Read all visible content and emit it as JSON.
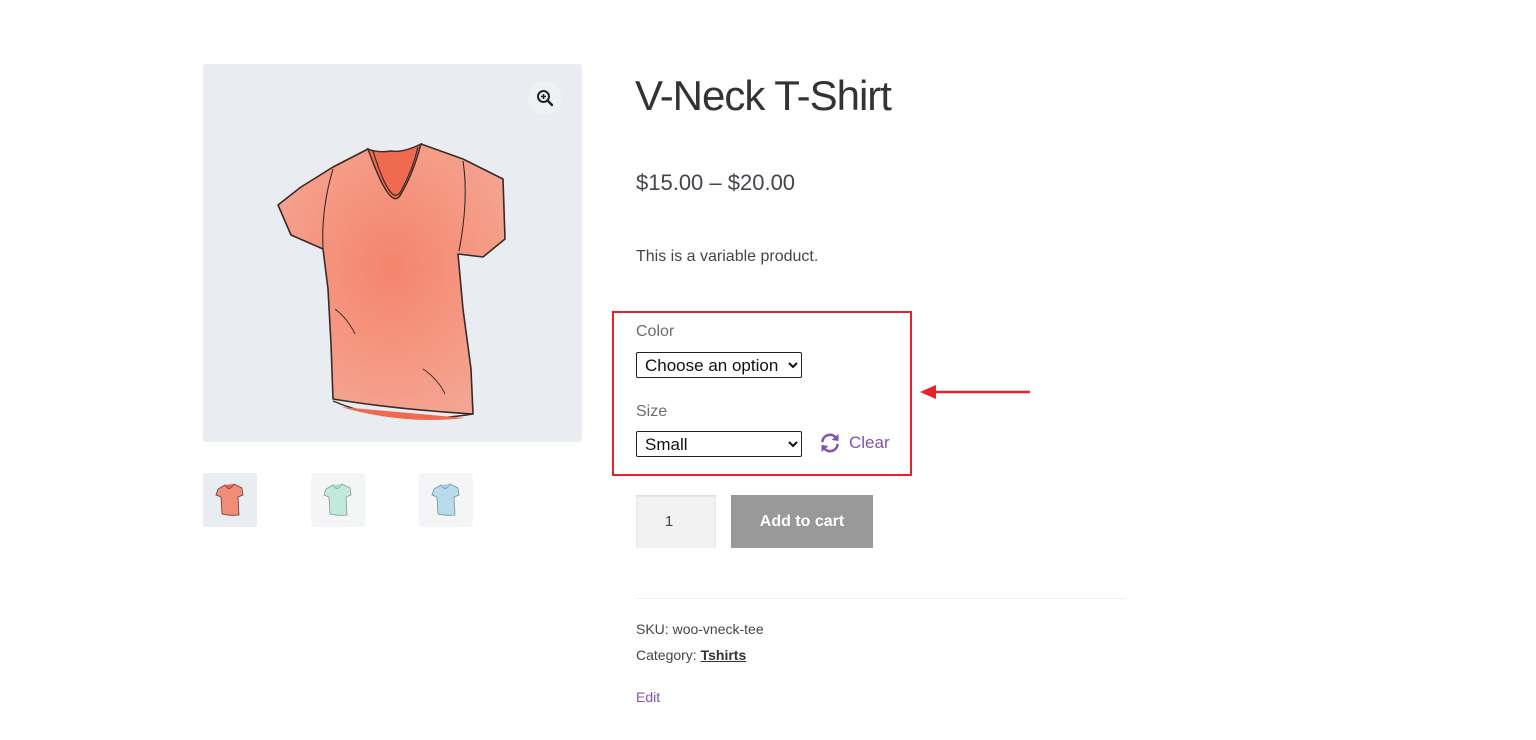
{
  "product": {
    "title": "V-Neck T-Shirt",
    "price": "$15.00 – $20.00",
    "description": "This is a variable product."
  },
  "gallery": {
    "zoom_icon": "zoom-in-icon",
    "thumbnails": [
      {
        "name": "pink-tshirt-thumbnail",
        "color": "#f08c78"
      },
      {
        "name": "green-tshirt-thumbnail",
        "color": "#bfe8d8"
      },
      {
        "name": "blue-tshirt-thumbnail",
        "color": "#b5dbe8"
      }
    ],
    "main_shirt_color": "#f4907c"
  },
  "variations": {
    "color": {
      "label": "Color",
      "selected": "Choose an option"
    },
    "size": {
      "label": "Size",
      "selected": "Small"
    },
    "clear_label": "Clear",
    "clear_icon": "refresh-icon",
    "highlight_color": "#e8222d"
  },
  "cart": {
    "quantity": "1",
    "add_to_cart_label": "Add to cart"
  },
  "meta": {
    "sku_label": "SKU:",
    "sku_value": "woo-vneck-tee",
    "category_label": "Category:",
    "category_value": "Tshirts"
  },
  "edit_label": "Edit",
  "colors": {
    "accent": "#7f54b3",
    "button_disabled": "#999999"
  }
}
